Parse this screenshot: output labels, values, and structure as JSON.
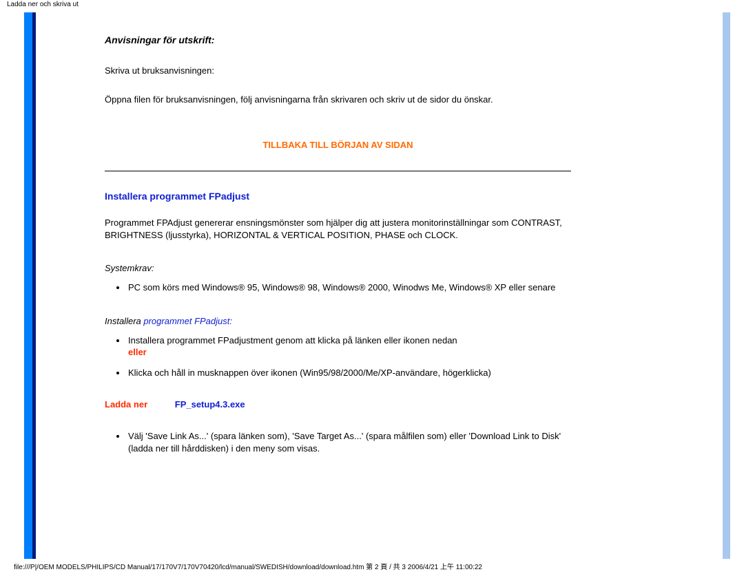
{
  "meta": {
    "header": "Ladda ner och skriva ut",
    "footer": "file:///P|/OEM MODELS/PHILIPS/CD Manual/17/170V7/170V70420/lcd/manual/SWEDISH/download/download.htm 第 2 頁 / 共 3 2006/4/21 上午 11:00:22"
  },
  "sec1": {
    "heading": "Anvisningar för utskrift:",
    "p1": "Skriva ut bruksanvisningen:",
    "p2": "Öppna filen för bruksanvisningen, följ anvisningarna från skrivaren och skriv ut de sidor du önskar."
  },
  "backlink": "TILLBAKA TILL BÖRJAN AV SIDAN",
  "sec2": {
    "title": "Installera programmet FPadjust",
    "p1": "Programmet FPAdjust genererar ensningsmönster som hjälper dig att justera monitorinställningar som CONTRAST, BRIGHTNESS (ljusstyrka), HORIZONTAL & VERTICAL POSITION, PHASE och CLOCK.",
    "sys_heading": "Systemkrav:",
    "sys_item": "PC som körs med Windows® 95, Windows® 98, Windows® 2000, Winodws Me, Windows® XP eller senare",
    "inst_prefix": "Installera ",
    "inst_linktext": "programmet FPadjust:",
    "li1_line1": "Installera programmet FPadjustment genom att klicka på länken eller ikonen nedan",
    "li1_eller": "eller",
    "li2": "Klicka och håll in musknappen över ikonen (Win95/98/2000/Me/XP-användare, högerklicka)",
    "download_label": "Ladda ner",
    "download_file": "FP_setup4.3.exe",
    "li3": "Välj 'Save Link As...' (spara länken som), 'Save Target As...' (spara målfilen som) eller 'Download Link to Disk' (ladda ner till hårddisken) i den meny som visas."
  }
}
